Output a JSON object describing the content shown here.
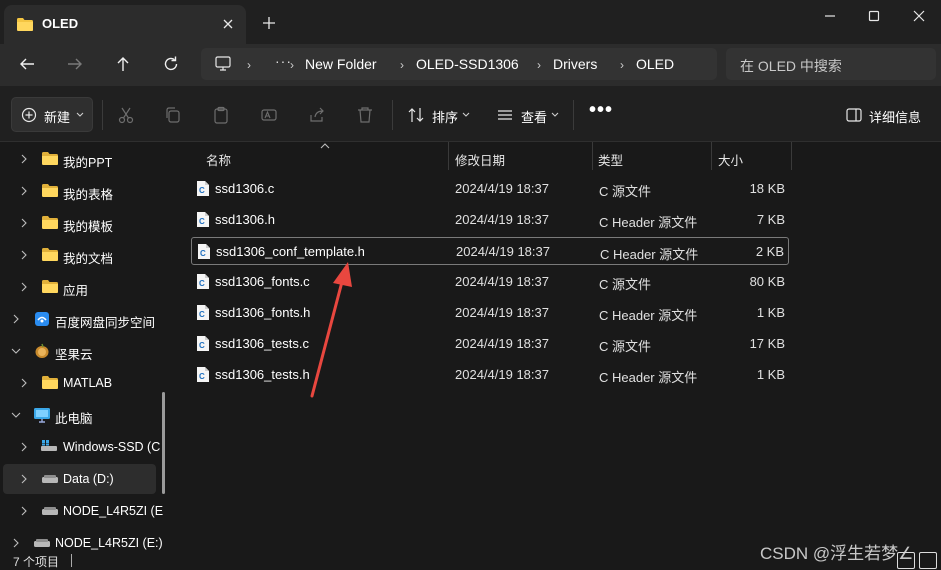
{
  "window": {
    "tab_title": "OLED",
    "new_tab_icon": "plus-icon"
  },
  "navigation": {
    "breadcrumbs": [
      "New Folder",
      "OLED-SSD1306",
      "Drivers",
      "OLED"
    ],
    "overflow": "···",
    "search_placeholder": "在 OLED 中搜索"
  },
  "toolbar": {
    "new_label": "新建",
    "sort_label": "排序",
    "view_label": "查看",
    "more_label": "•••",
    "details_label": "详细信息"
  },
  "sidebar": {
    "items": [
      {
        "label": "我的PPT",
        "icon": "folder-icon"
      },
      {
        "label": "我的表格",
        "icon": "folder-icon"
      },
      {
        "label": "我的模板",
        "icon": "folder-icon"
      },
      {
        "label": "我的文档",
        "icon": "folder-icon"
      },
      {
        "label": "应用",
        "icon": "folder-icon"
      },
      {
        "label": "百度网盘同步空间",
        "icon": "baidu-netdisk-icon"
      },
      {
        "label": "坚果云",
        "icon": "jianguoyun-icon"
      },
      {
        "label": "MATLAB",
        "icon": "folder-icon"
      },
      {
        "label": "此电脑",
        "icon": "computer-icon"
      },
      {
        "label": "Windows-SSD (C",
        "icon": "drive-icon"
      },
      {
        "label": "Data (D:)",
        "icon": "drive-icon"
      },
      {
        "label": "NODE_L4R5ZI (E",
        "icon": "drive-icon"
      },
      {
        "label": "NODE_L4R5ZI (E:)",
        "icon": "drive-icon"
      }
    ]
  },
  "columns": {
    "name": "名称",
    "modified": "修改日期",
    "type": "类型",
    "size": "大小"
  },
  "files": [
    {
      "name": "ssd1306.c",
      "modified": "2024/4/19 18:37",
      "type": "C 源文件",
      "size": "18 KB"
    },
    {
      "name": "ssd1306.h",
      "modified": "2024/4/19 18:37",
      "type": "C Header 源文件",
      "size": "7 KB"
    },
    {
      "name": "ssd1306_conf_template.h",
      "modified": "2024/4/19 18:37",
      "type": "C Header 源文件",
      "size": "2 KB"
    },
    {
      "name": "ssd1306_fonts.c",
      "modified": "2024/4/19 18:37",
      "type": "C 源文件",
      "size": "80 KB"
    },
    {
      "name": "ssd1306_fonts.h",
      "modified": "2024/4/19 18:37",
      "type": "C Header 源文件",
      "size": "1 KB"
    },
    {
      "name": "ssd1306_tests.c",
      "modified": "2024/4/19 18:37",
      "type": "C 源文件",
      "size": "17 KB"
    },
    {
      "name": "ssd1306_tests.h",
      "modified": "2024/4/19 18:37",
      "type": "C Header 源文件",
      "size": "1 KB"
    }
  ],
  "status": {
    "item_count": "7 个项目",
    "watermark": "CSDN @浮生若梦∠"
  },
  "colors": {
    "folder": "#f4c542",
    "annotation_arrow": "#e8473f",
    "background": "#191919"
  }
}
